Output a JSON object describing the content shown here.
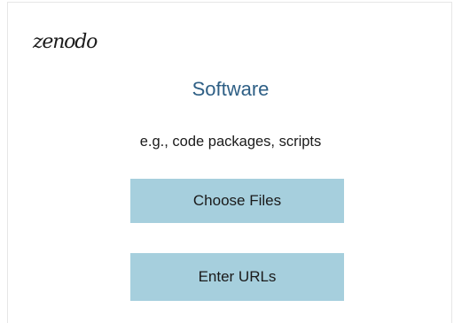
{
  "app": {
    "logo_text": "zenodo"
  },
  "panel": {
    "title": "Software",
    "subtitle": "e.g., code packages, scripts"
  },
  "actions": {
    "choose_files_label": "Choose Files",
    "enter_urls_label": "Enter URLs"
  },
  "colors": {
    "title": "#2e5f85",
    "button_bg": "#a6cfdd",
    "text": "#1a1a1a"
  }
}
